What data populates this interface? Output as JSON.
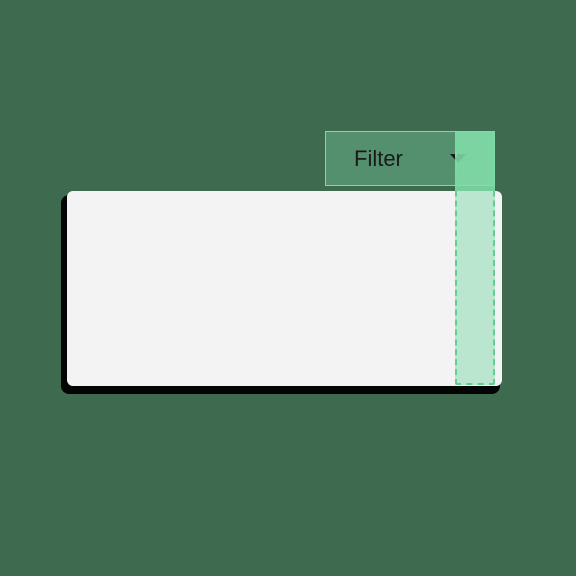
{
  "filter": {
    "label": "Filter"
  }
}
